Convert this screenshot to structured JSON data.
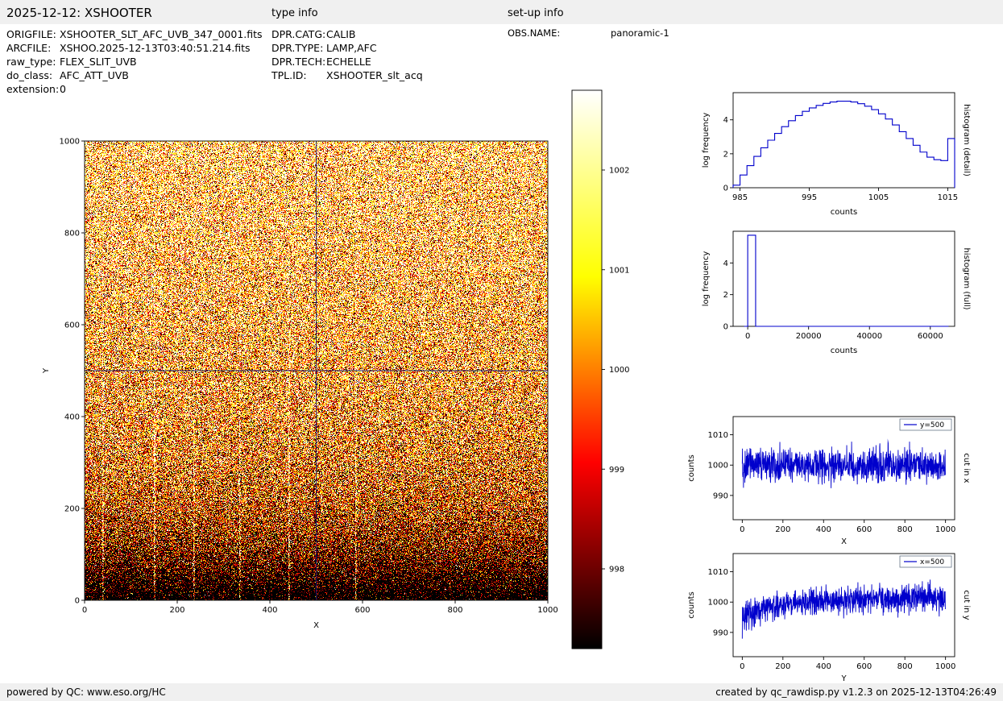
{
  "header": {
    "title": "2025-12-12: XSHOOTER",
    "type_info_label": "type info",
    "setup_info_label": "set-up info"
  },
  "file_info": {
    "rows": [
      {
        "label": "ORIGFILE:",
        "value": "XSHOOTER_SLT_AFC_UVB_347_0001.fits"
      },
      {
        "label": "ARCFILE:",
        "value": "XSHOO.2025-12-13T03:40:51.214.fits"
      },
      {
        "label": "raw_type:",
        "value": "FLEX_SLIT_UVB"
      },
      {
        "label": "do_class:",
        "value": "AFC_ATT_UVB"
      },
      {
        "label": "extension:",
        "value": "0"
      }
    ]
  },
  "type_info": {
    "rows": [
      {
        "label": "DPR.CATG:",
        "value": "CALIB"
      },
      {
        "label": "DPR.TYPE:",
        "value": "LAMP,AFC"
      },
      {
        "label": "DPR.TECH:",
        "value": "ECHELLE"
      },
      {
        "label": "TPL.ID:",
        "value": "XSHOOTER_slt_acq"
      }
    ]
  },
  "setup_info": {
    "rows": [
      {
        "label": "OBS.NAME:",
        "value": "panoramic-1"
      }
    ]
  },
  "footer": {
    "left": "powered by QC: www.eso.org/HC",
    "right": "created by qc_rawdisp.py v1.2.3 on 2025-12-13T04:26:49"
  },
  "colors": {
    "bar_bg": "#f0f0f0",
    "plot_blue": "#0000cc",
    "crosshair": "#1a1a6e",
    "legend_border": "#667788"
  },
  "chart_data": [
    {
      "id": "detector-image",
      "type": "heatmap",
      "xlabel": "X",
      "ylabel": "Y",
      "xlim": [
        0,
        1000
      ],
      "ylim": [
        0,
        1000
      ],
      "xticks": [
        0,
        200,
        400,
        600,
        800,
        1000
      ],
      "yticks": [
        0,
        200,
        400,
        600,
        800,
        1000
      ],
      "colormap": "hot",
      "vmin": 997.2,
      "vmax": 1002.8,
      "noise": {
        "mean": 1000,
        "sigma": 2.2,
        "seed": 1234567
      },
      "vertical_gradient": {
        "drop": 5,
        "scale": 130,
        "slope": 0.0015
      },
      "streaks": {
        "x": [
          38,
          150,
          235,
          335,
          440,
          585
        ],
        "amplitude": 4,
        "fade_scale": 350
      },
      "crosshair": {
        "x": 500,
        "y": 500
      }
    },
    {
      "id": "colorbar",
      "type": "colorbar",
      "colormap": "hot",
      "vmin": 997.2,
      "vmax": 1002.8,
      "ticks": [
        998,
        999,
        1000,
        1001,
        1002
      ]
    },
    {
      "id": "histogram-detail",
      "type": "histogram",
      "right_label": "histogram (detail)",
      "xlabel": "counts",
      "ylabel": "log frequency",
      "xlim": [
        984,
        1016
      ],
      "ylim": [
        0,
        5.6
      ],
      "xticks": [
        985,
        995,
        1005,
        1015
      ],
      "yticks": [
        0,
        2,
        4
      ],
      "edges": [
        984,
        985,
        986,
        987,
        988,
        989,
        990,
        991,
        992,
        993,
        994,
        995,
        996,
        997,
        998,
        999,
        1000,
        1001,
        1002,
        1003,
        1004,
        1005,
        1006,
        1007,
        1008,
        1009,
        1010,
        1011,
        1012,
        1013,
        1014,
        1015,
        1016
      ],
      "values": [
        0.15,
        0.75,
        1.3,
        1.85,
        2.35,
        2.8,
        3.2,
        3.6,
        3.95,
        4.25,
        4.5,
        4.7,
        4.85,
        4.97,
        5.05,
        5.1,
        5.1,
        5.05,
        4.95,
        4.8,
        4.6,
        4.35,
        4.05,
        3.7,
        3.3,
        2.9,
        2.5,
        2.1,
        1.8,
        1.65,
        1.6,
        2.9
      ]
    },
    {
      "id": "histogram-full",
      "type": "histogram",
      "right_label": "histogram (full)",
      "xlabel": "counts",
      "ylabel": "log frequency",
      "xlim": [
        -4800,
        68000
      ],
      "ylim": [
        0,
        6
      ],
      "xticks": [
        0,
        20000,
        40000,
        60000
      ],
      "yticks": [
        0,
        2,
        4
      ],
      "edges": [
        -1200,
        0,
        2600,
        66000
      ],
      "values": [
        0,
        5.75,
        0
      ]
    },
    {
      "id": "cut-in-x",
      "type": "line",
      "legend": "y=500",
      "right_label": "cut in x",
      "xlabel": "X",
      "ylabel": "counts",
      "xlim": [
        -45,
        1045
      ],
      "ylim": [
        982,
        1016
      ],
      "xticks": [
        0,
        200,
        400,
        600,
        800,
        1000
      ],
      "yticks": [
        990,
        1000,
        1010
      ],
      "series": {
        "n": 1000,
        "mean": 1000,
        "sigma": 2.7,
        "seed": 424242
      }
    },
    {
      "id": "cut-in-y",
      "type": "line",
      "legend": "x=500",
      "right_label": "cut in y",
      "xlabel": "Y",
      "ylabel": "counts",
      "xlim": [
        -45,
        1045
      ],
      "ylim": [
        982,
        1016
      ],
      "xticks": [
        0,
        200,
        400,
        600,
        800,
        1000
      ],
      "yticks": [
        990,
        1000,
        1010
      ],
      "series": {
        "n": 1000,
        "mean": 1000,
        "sigma": 2.3,
        "seed": 987654,
        "trend": {
          "drop": 5,
          "scale": 130,
          "slope": 0.0015
        }
      }
    }
  ]
}
